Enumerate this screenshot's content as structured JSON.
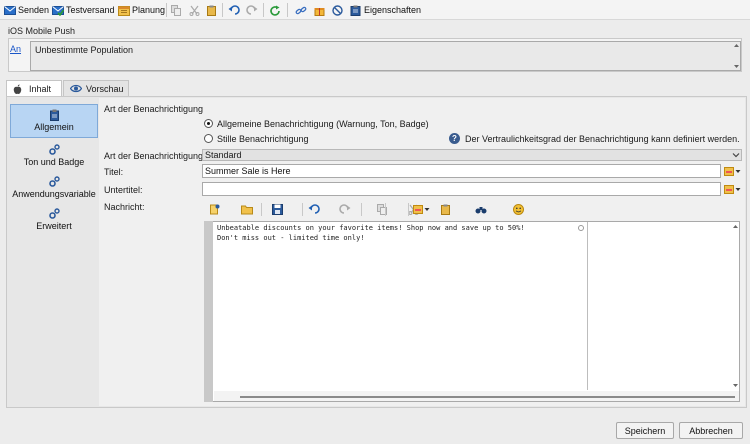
{
  "toolbar": {
    "send_label": "Senden",
    "test_label": "Testversand",
    "plan_label": "Planung",
    "props_label": "Eigenschaften"
  },
  "header": {
    "title": "iOS Mobile Push",
    "audience_link": "An",
    "audience_value": "Unbestimmte Population"
  },
  "tabs": [
    {
      "label": "Inhalt",
      "active": true
    },
    {
      "label": "Vorschau",
      "active": false
    }
  ],
  "sidebar": {
    "items": [
      {
        "label": "Allgemein",
        "icon": "clipboard-icon",
        "selected": true
      },
      {
        "label": "Ton und Badge",
        "icon": "gears-icon"
      },
      {
        "label": "Anwendungsvariable",
        "icon": "gears-icon"
      },
      {
        "label": "Erweitert",
        "icon": "gears-icon"
      }
    ]
  },
  "form": {
    "section_label": "Art der Benachrichtigung",
    "radio_general": "Allgemeine Benachrichtigung (Warnung, Ton, Badge)",
    "radio_silent": "Stille Benachrichtigung",
    "selected_radio": "general",
    "help_text": "Der Vertraulichkeitsgrad der Benachrichtigung kann definiert werden.",
    "type_label": "Art der Benachrichtigung:",
    "type_value": "Standard",
    "title_label": "Titel:",
    "title_value": "Summer Sale is Here",
    "subtitle_label": "Untertitel:",
    "subtitle_value": "",
    "message_label": "Nachricht:",
    "message_value": "Unbeatable discounts on your favorite items! Shop now and save up to 50%!\nDon't miss out - limited time only!"
  },
  "footer": {
    "save_label": "Speichern",
    "cancel_label": "Abbrechen"
  },
  "colors": {
    "selected_bg": "#b8d5f3",
    "link": "#1a56c8",
    "panel_bg": "#f0f0f0"
  }
}
